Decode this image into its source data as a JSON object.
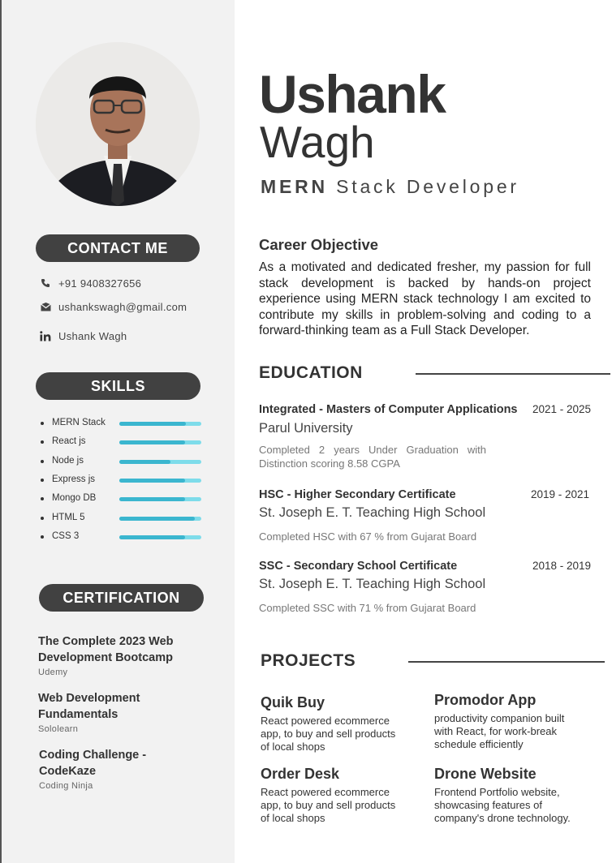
{
  "profile": {
    "first_name": "Ushank",
    "last_name": "Wagh",
    "role_bold": "MERN",
    "role_rest": "Stack Developer"
  },
  "contact": {
    "heading": "CONTACT ME",
    "phone": "+91 9408327656",
    "email": "ushankswagh@gmail.com",
    "linkedin": "Ushank Wagh"
  },
  "skills": {
    "heading": "SKILLS",
    "items": [
      {
        "name": "MERN Stack",
        "level": 0.81
      },
      {
        "name": "React js",
        "level": 0.8
      },
      {
        "name": "Node js",
        "level": 0.62
      },
      {
        "name": "Express js",
        "level": 0.8
      },
      {
        "name": "Mongo DB",
        "level": 0.8
      },
      {
        "name": "HTML 5",
        "level": 0.92
      },
      {
        "name": "CSS 3",
        "level": 0.8
      }
    ]
  },
  "certification": {
    "heading": "CERTIFICATION",
    "items": [
      {
        "title_line1": "The Complete 2023 Web",
        "title_line2": "Development Bootcamp",
        "issuer": "Udemy"
      },
      {
        "title_line1": "Web Development",
        "title_line2": "Fundamentals",
        "issuer": "Sololearn"
      },
      {
        "title_line1": "Coding Challenge -",
        "title_line2": "CodeKaze",
        "issuer": "Coding Ninja"
      }
    ]
  },
  "objective": {
    "heading": "Career Objective",
    "text": "As a motivated and dedicated fresher, my passion for full stack development is backed by hands-on project experience using MERN stack technology I am excited to contribute my skills in problem-solving and coding to a forward-thinking team as a Full Stack Developer."
  },
  "education": {
    "heading": "EDUCATION",
    "items": [
      {
        "degree": "Integrated - Masters of Computer Applications",
        "years": "2021 - 2025",
        "school": "Parul University",
        "note": "Completed 2 years Under Graduation with Distinction scoring 8.58 CGPA"
      },
      {
        "degree": "HSC - Higher Secondary Certificate",
        "years": "2019 - 2021",
        "school": "St. Joseph E. T. Teaching High School",
        "note": "Completed HSC with 67 % from Gujarat Board"
      },
      {
        "degree": "SSC - Secondary School Certificate",
        "years": "2018 - 2019",
        "school": "St. Joseph E. T. Teaching High School",
        "note": "Completed SSC with 71 % from Gujarat Board"
      }
    ]
  },
  "projects": {
    "heading": "PROJECTS",
    "items": [
      {
        "title": "Quik Buy",
        "desc": "React powered ecommerce app, to buy and sell products of local shops"
      },
      {
        "title": "Promodor App",
        "desc": "productivity companion built with React, for work-break schedule efficiently"
      },
      {
        "title": "Order Desk",
        "desc": "React powered ecommerce app, to buy and sell products of local shops"
      },
      {
        "title": "Drone Website",
        "desc": "Frontend Portfolio website, showcasing features of company's drone technology."
      }
    ]
  }
}
